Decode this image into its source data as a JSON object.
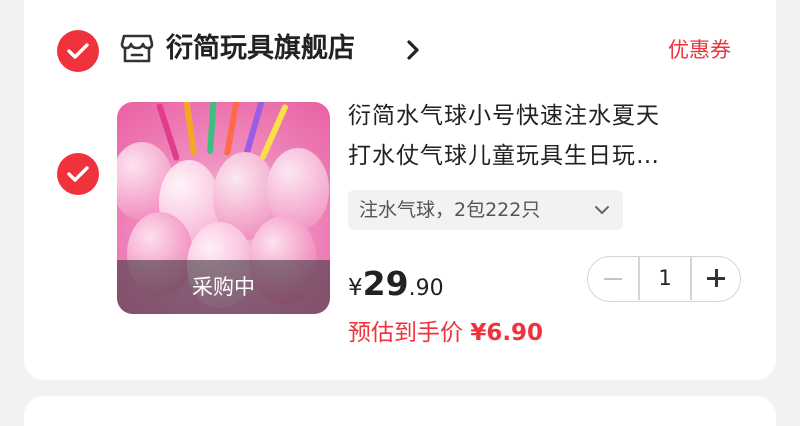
{
  "store": {
    "name": "衍简玩具旗舰店",
    "coupon_label": "优惠券",
    "selected": true
  },
  "item": {
    "selected": true,
    "title_line1": "衍简水气球小号快速注水夏天",
    "title_line2": "打水仗气球儿童玩具生日玩…",
    "thumbnail_badge": "采购中",
    "sku": "注水气球，2包222只",
    "price": {
      "currency": "¥",
      "integer": "29",
      "decimal": ".90"
    },
    "estimate_label": "预估到手价",
    "estimate_value": "¥6.90",
    "quantity": "1"
  },
  "icons": {
    "check": "check-icon",
    "store": "store-icon",
    "chevron": "chevron-right-icon",
    "sku_dropdown": "chevron-down-icon",
    "minus": "minus-icon",
    "plus": "plus-icon"
  },
  "colors": {
    "accent": "#f0323c",
    "text": "#222222",
    "sku_bg": "#f2f2f2",
    "page_bg": "#f2f2f2"
  }
}
